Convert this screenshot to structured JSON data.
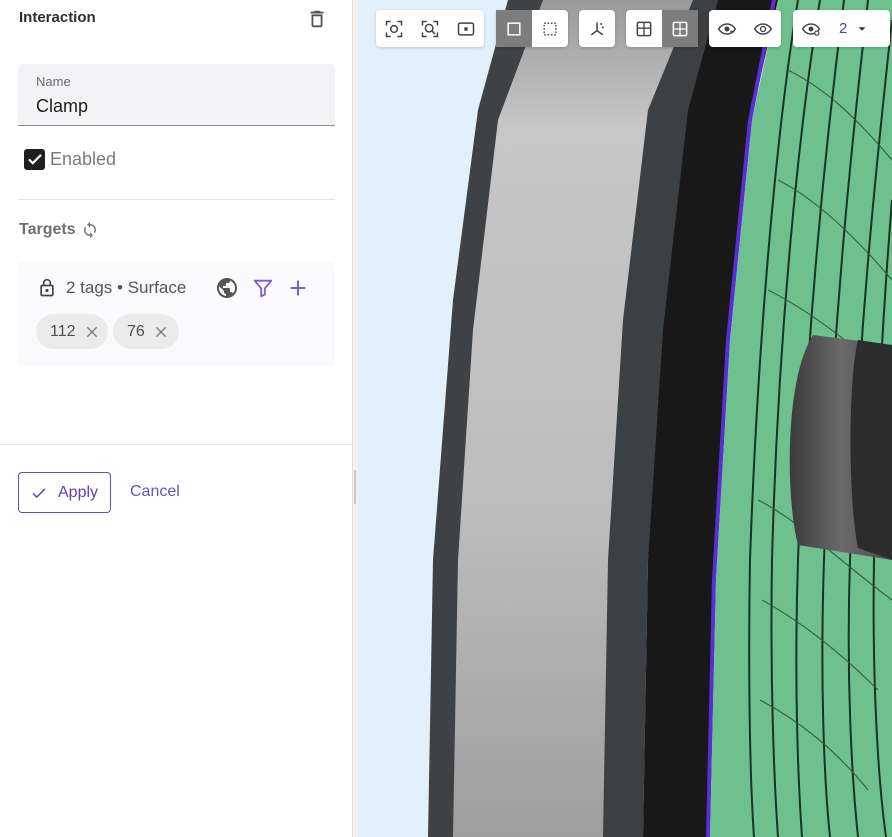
{
  "panel": {
    "title": "Interaction",
    "name_field": {
      "label": "Name",
      "value": "Clamp"
    },
    "enabled": {
      "label": "Enabled",
      "checked": true
    },
    "targets": {
      "label": "Targets",
      "summary": "2 tags • Surface",
      "chips": [
        {
          "label": "112"
        },
        {
          "label": "76"
        }
      ]
    },
    "actions": {
      "apply_label": "Apply",
      "cancel_label": "Cancel"
    }
  },
  "viewport": {
    "toolbar": {
      "layer_count": "2"
    }
  },
  "colors": {
    "accent": "#6b46c1",
    "viewport_bg": "#e1f0fb",
    "model_green": "#6fc08f",
    "model_gray": "#bdbdbd"
  },
  "icons": [
    "delete-icon",
    "refresh-icon",
    "lock-icon",
    "globe-icon",
    "filter-icon",
    "plus-icon",
    "close-icon",
    "check-icon",
    "zoom-fit-icon",
    "zoom-icon",
    "zoom-region-icon",
    "select-box-icon",
    "select-dashed-icon",
    "axes-icon",
    "section-view-icon",
    "grid-view-icon",
    "hide-icon",
    "show-icon",
    "layer-visibility-icon",
    "chevron-down-icon"
  ]
}
